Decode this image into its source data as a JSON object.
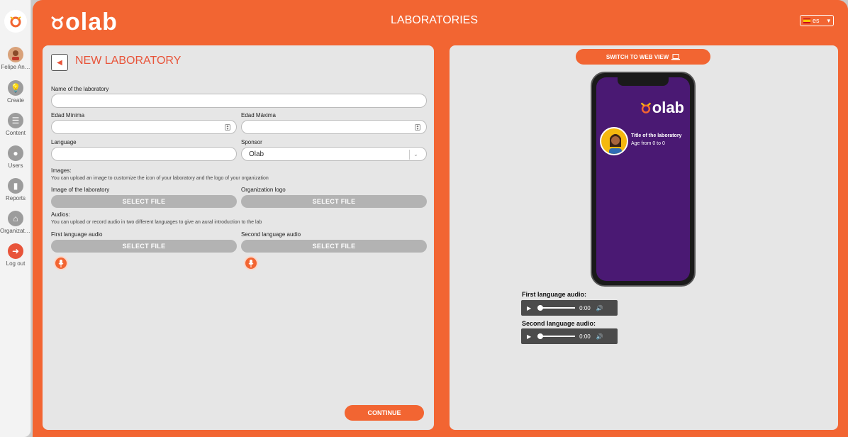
{
  "sidebar": {
    "items": [
      {
        "label": "Felipe An…",
        "icon": "user-avatar-icon"
      },
      {
        "label": "Create",
        "icon": "lightbulb-icon"
      },
      {
        "label": "Content",
        "icon": "list-icon"
      },
      {
        "label": "Users",
        "icon": "person-icon"
      },
      {
        "label": "Reports",
        "icon": "bar-chart-icon"
      },
      {
        "label": "Organizati…",
        "icon": "bank-icon"
      },
      {
        "label": "Log out",
        "icon": "logout-icon"
      }
    ]
  },
  "header": {
    "brand": "olab",
    "title": "LABORATORIES",
    "language": "es"
  },
  "form": {
    "title": "NEW LABORATORY",
    "name_label": "Name of the laboratory",
    "min_age_label": "Edad Mínima",
    "max_age_label": "Edad Máxima",
    "language_label": "Language",
    "sponsor_label": "Sponsor",
    "sponsor_value": "Olab",
    "images_label": "Images:",
    "images_help": "You can upload an image to customize the icon of your laboratory and the logo of your organization",
    "lab_image_label": "Image of the laboratory",
    "org_logo_label": "Organization logo",
    "select_file": "SELECT FILE",
    "audios_label": "Audios:",
    "audios_help": "You can upload or record audio in two different languages to give an aural introduction to the lab",
    "first_audio_label": "First language audio",
    "second_audio_label": "Second language audio",
    "continue": "CONTINUE"
  },
  "preview": {
    "switch_label": "SWITCH TO WEB VIEW",
    "phone_brand": "olab",
    "lab_title": "Title of the laboratory",
    "age_text": "Age from 0 to 0",
    "first_audio_label": "First language audio:",
    "second_audio_label": "Second language audio:",
    "time": "0:00"
  },
  "colors": {
    "accent": "#f26532",
    "phone_screen": "#4a1973"
  }
}
